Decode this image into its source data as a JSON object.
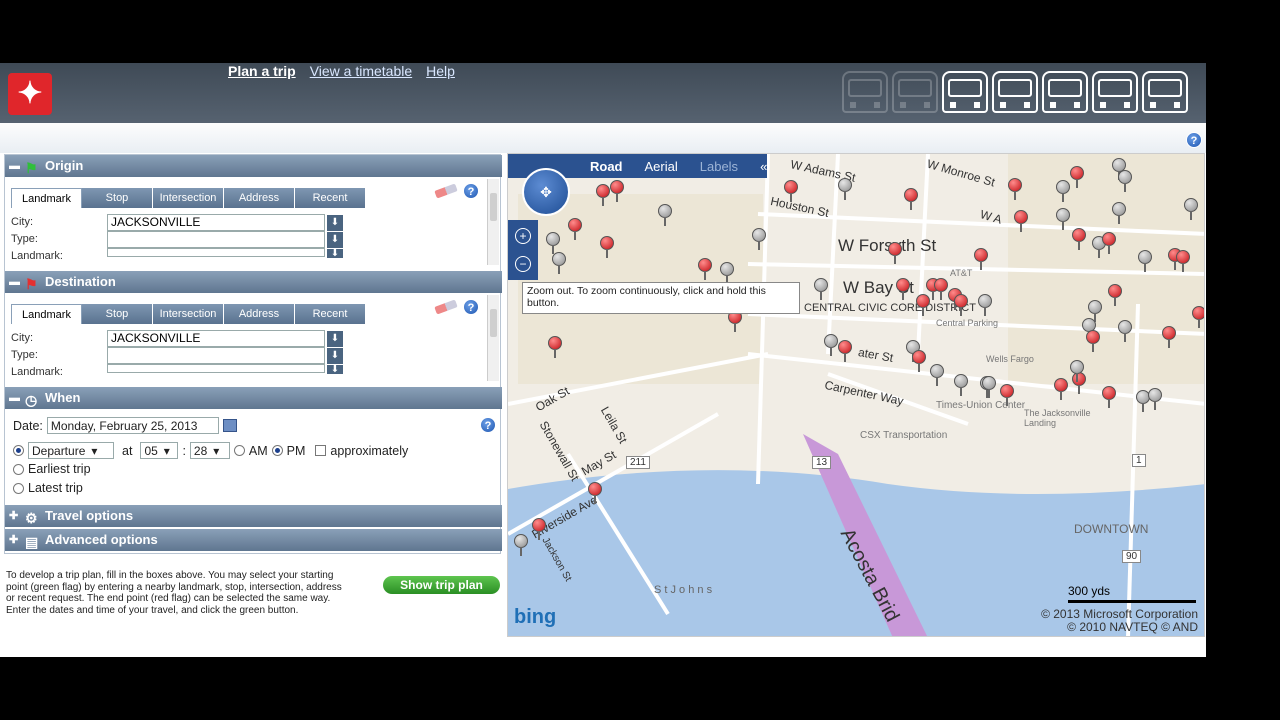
{
  "header": {
    "nav": [
      "Plan a trip",
      "View a timetable",
      "Help"
    ],
    "logo_icon": "jta-logo-icon",
    "vehicle_icons": [
      "bus-icon",
      "bus-icon",
      "bus-icon",
      "van-icon",
      "car-icon",
      "streetcar-icon",
      "skyway-icon"
    ]
  },
  "origin": {
    "title": "Origin",
    "tabs": [
      "Landmark",
      "Stop",
      "Intersection",
      "Address",
      "Recent"
    ],
    "selected_tab": "Landmark",
    "fields": [
      {
        "label": "City:",
        "value": "JACKSONVILLE"
      },
      {
        "label": "Type:",
        "value": ""
      },
      {
        "label": "Landmark:",
        "value": ""
      }
    ]
  },
  "destination": {
    "title": "Destination",
    "tabs": [
      "Landmark",
      "Stop",
      "Intersection",
      "Address",
      "Recent"
    ],
    "selected_tab": "Landmark",
    "fields": [
      {
        "label": "City:",
        "value": "JACKSONVILLE"
      },
      {
        "label": "Type:",
        "value": ""
      },
      {
        "label": "Landmark:",
        "value": ""
      }
    ]
  },
  "when": {
    "title": "When",
    "date_label": "Date:",
    "date_value": "Monday, February 25, 2013",
    "departure_option": "Departure",
    "at_label": "at",
    "hour": "05",
    "colon": ":",
    "minute": "28",
    "am": "AM",
    "pm": "PM",
    "approx": "approximately",
    "earliest": "Earliest trip",
    "latest": "Latest trip"
  },
  "sections": {
    "travel_options": "Travel options",
    "advanced_options": "Advanced options"
  },
  "instructions": "To develop a trip plan, fill in the boxes above. You may select your starting point (green flag) by entering a nearby landmark, stop, intersection, address or recent request. The end point (red flag) can be selected the same way. Enter the dates and time of your travel, and click the green button.",
  "show_trip": "Show trip plan",
  "map": {
    "tabs": [
      "Road",
      "Aerial",
      "Labels"
    ],
    "collapse": "«",
    "tooltip": "Zoom out. To zoom continuously, click and hold this button.",
    "labels": {
      "w_forsyth": "W Forsyth St",
      "w_bay": "W Bay St",
      "civic": "CENTRAL CIVIC CORE DISTRICT",
      "w_adams": "W Adams St",
      "hogan": "Houston St",
      "w_monroe": "W Monroe St",
      "w_a": "W A",
      "water": "ater St",
      "carpenter": "Carpenter Way",
      "oak": "Oak St",
      "leila": "Leila St",
      "stonewall": "Stonewall St",
      "may": "May St",
      "riverside": "Riverside Ave",
      "jackson": "Jackson St",
      "acosta": "Acosta Brid",
      "downtown": "DOWNTOWN",
      "times": "Times-Union Center",
      "csx": "CSX Transportation",
      "jax_landing": "The Jacksonville Landing",
      "att": "AT&T",
      "central_parking": "Central Parking",
      "wells": "Wells Fargo",
      "stjohns": "S t   J o h n s",
      "r13": "13",
      "r211": "211",
      "r1": "1",
      "r90": "90"
    },
    "scale": "300 yds",
    "copyright_1": "© 2013 Microsoft Corporation",
    "copyright_2": "© 2010 NAVTEQ   © AND",
    "brand": "bing"
  }
}
